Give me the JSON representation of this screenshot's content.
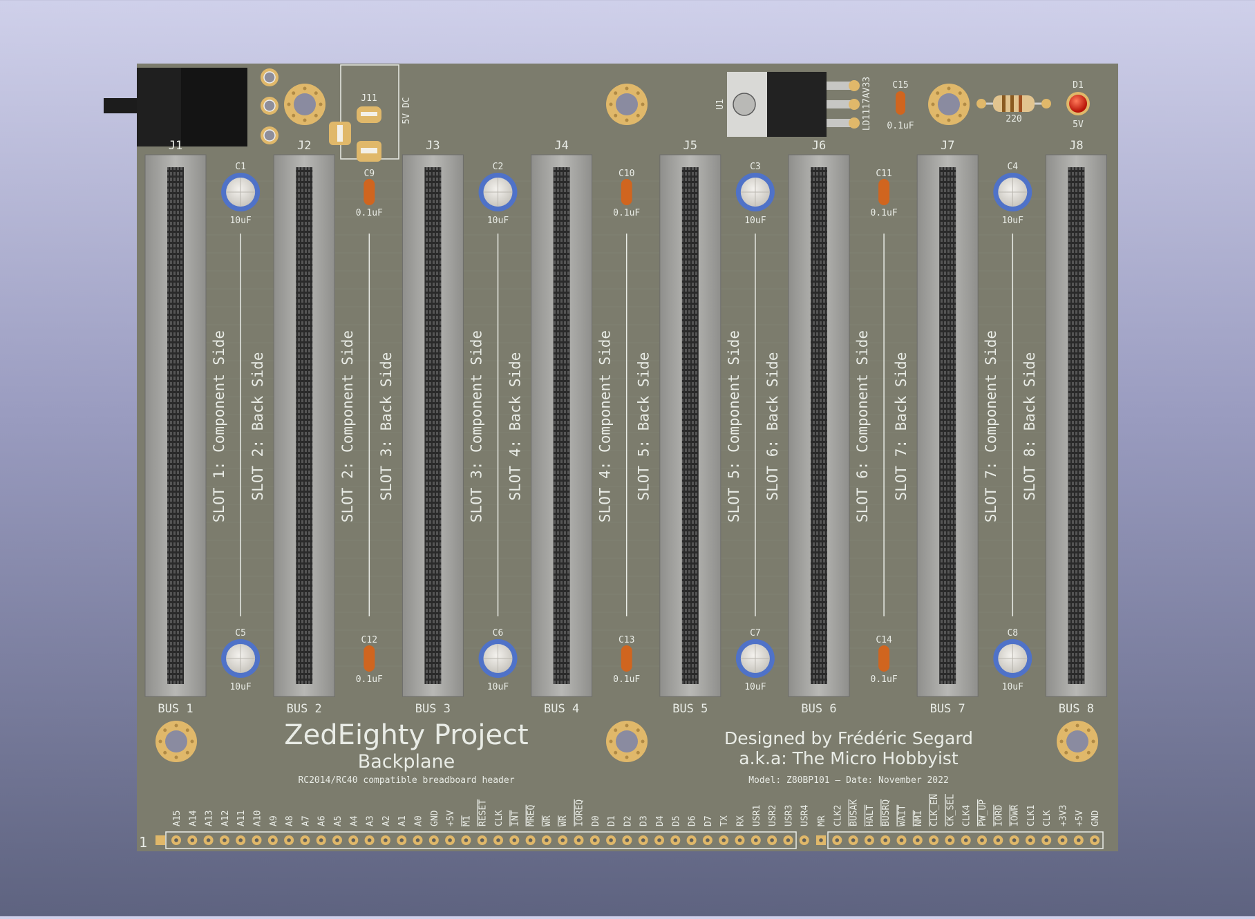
{
  "slots": [
    {
      "bus": "BUS 1",
      "ref": "J1",
      "component_side": "SLOT 1: Component Side",
      "back_side": "SLOT 2: Back Side",
      "cap_top": {
        "ref": "C1",
        "value": "10uF"
      },
      "cap_bottom": {
        "ref": "C5",
        "value": "10uF"
      }
    },
    {
      "bus": "BUS 2",
      "ref": "J2",
      "component_side": "SLOT 2: Component Side",
      "back_side": "SLOT 3: Back Side",
      "cap_top": {
        "ref": "C9",
        "value": "0.1uF"
      },
      "cap_bottom": {
        "ref": "C12",
        "value": "0.1uF"
      }
    },
    {
      "bus": "BUS 3",
      "ref": "J3",
      "component_side": "SLOT 3: Component Side",
      "back_side": "SLOT 4: Back Side",
      "cap_top": {
        "ref": "C2",
        "value": "10uF"
      },
      "cap_bottom": {
        "ref": "C6",
        "value": "10uF"
      }
    },
    {
      "bus": "BUS 4",
      "ref": "J4",
      "component_side": "SLOT 4: Component Side",
      "back_side": "SLOT 5: Back Side",
      "cap_top": {
        "ref": "C10",
        "value": "0.1uF"
      },
      "cap_bottom": {
        "ref": "C13",
        "value": "0.1uF"
      }
    },
    {
      "bus": "BUS 5",
      "ref": "J5",
      "component_side": "SLOT 5: Component Side",
      "back_side": "SLOT 6: Back Side",
      "cap_top": {
        "ref": "C3",
        "value": "10uF"
      },
      "cap_bottom": {
        "ref": "C7",
        "value": "10uF"
      }
    },
    {
      "bus": "BUS 6",
      "ref": "J6",
      "component_side": "SLOT 6: Component Side",
      "back_side": "SLOT 7: Back Side",
      "cap_top": {
        "ref": "C11",
        "value": "0.1uF"
      },
      "cap_bottom": {
        "ref": "C14",
        "value": "0.1uF"
      }
    },
    {
      "bus": "BUS 7",
      "ref": "J7",
      "component_side": "SLOT 7: Component Side",
      "back_side": "SLOT 8: Back Side",
      "cap_top": {
        "ref": "C4",
        "value": "10uF"
      },
      "cap_bottom": {
        "ref": "C8",
        "value": "10uF"
      }
    },
    {
      "bus": "BUS 8",
      "ref": "J8"
    }
  ],
  "power": {
    "jack_label": "5V DC",
    "header_ref": "J11",
    "regulator_ref": "U1",
    "regulator_part": "LD1117AV33",
    "cap_ref": "C15",
    "cap_value": "0.1uF",
    "resistor_value": "220",
    "led_ref": "D1",
    "led_label": "5V"
  },
  "title_block": {
    "project": "ZedEighty Project",
    "board": "Backplane",
    "tagline": "RC2014/RC40 compatible breadboard header",
    "designer": "Designed by Frédéric Segard",
    "aka": "a.k.a: The Micro Hobbyist",
    "model": "Model: Z80BP101 – Date: November 2022"
  },
  "header": {
    "pin1_label": "1",
    "left_pins": [
      "A15",
      "A14",
      "A13",
      "A12",
      "A11",
      "A10",
      "A9",
      "A8",
      "A7",
      "A6",
      "A5",
      "A4",
      "A3",
      "A2",
      "A1",
      "A0",
      "GND",
      "+5V",
      "M1",
      "RESET",
      "CLK",
      "INT",
      "MREQ",
      "WR",
      "WR",
      "IOREQ",
      "D0",
      "D1",
      "D2",
      "D3",
      "D4",
      "D5",
      "D6",
      "D7",
      "TX",
      "RX",
      "USR1",
      "USR2",
      "USR3",
      "USR4"
    ],
    "right_pins": [
      "MR",
      "CLK2",
      "BUSAK",
      "HALT",
      "BUSRQ",
      "WAIT",
      "NMI",
      "CLK_EN",
      "CK_SEL",
      "CLK4",
      "PW_UP",
      "IORD",
      "IOWR",
      "CLK1",
      "CLK",
      "+3V3",
      "+5V",
      "GND"
    ],
    "overlined": [
      "M1",
      "RESET",
      "INT",
      "MREQ",
      "WR",
      "IOREQ",
      "BUSAK",
      "HALT",
      "BUSRQ",
      "WAIT",
      "NMI",
      "CLK_EN",
      "CK_SEL",
      "PW_UP",
      "IORD",
      "IOWR"
    ]
  },
  "colors": {
    "pcb": "#7c7c6d",
    "silkscreen": "#e9ece6",
    "gold_pad": "#e0b86a",
    "slot_body": "#a9a9a6",
    "electrolytic": "#4f72c8",
    "ceramic": "#d0651f",
    "led": "#e02010"
  }
}
